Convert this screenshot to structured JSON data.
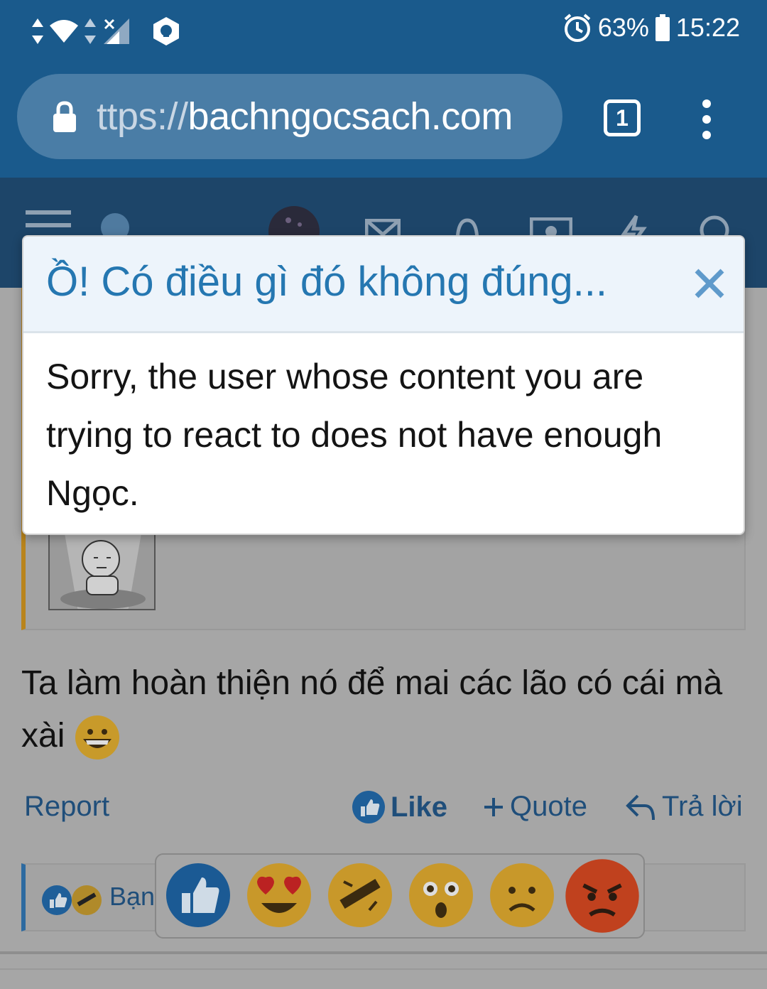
{
  "status_bar": {
    "battery": "63%",
    "time": "15:22"
  },
  "browser": {
    "url_scheme": "ttps://",
    "url_host": "bachngocsach.com",
    "tab_count": "1"
  },
  "dialog": {
    "title": "Ồ! Có điều gì đó không đúng...",
    "message": "Sorry, the user whose content you are trying to react to does not have enough Ngọc."
  },
  "post": {
    "text": "Ta làm hoàn thiện nó để mai các lão có cái mà xài"
  },
  "actions": {
    "report": "Report",
    "like": "Like",
    "quote": "Quote",
    "reply": "Trả lời"
  },
  "reactions": {
    "summary_label": "Bạn",
    "picker": [
      "like",
      "love",
      "haha",
      "wow",
      "sad",
      "angry"
    ]
  },
  "colors": {
    "brand_blue": "#1a5a8c",
    "header_blue": "#1d4569",
    "dialog_title": "#2577b1",
    "link": "#1f4e7a"
  }
}
